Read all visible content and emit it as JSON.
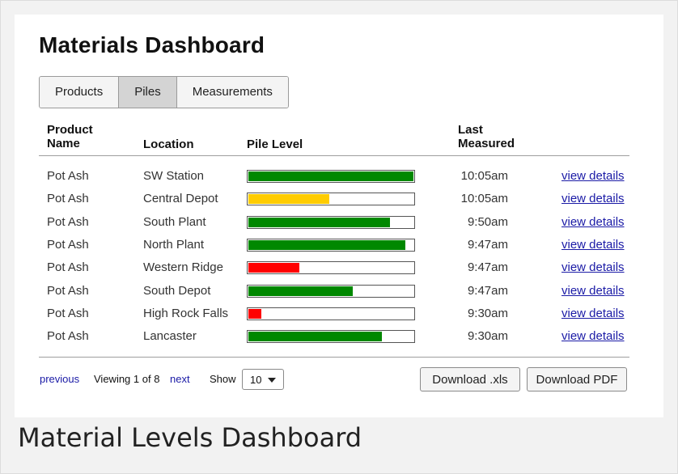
{
  "page": {
    "title": "Materials Dashboard",
    "caption": "Material Levels Dashboard"
  },
  "tabs": [
    {
      "label": "Products",
      "active": false
    },
    {
      "label": "Piles",
      "active": true
    },
    {
      "label": "Measurements",
      "active": false
    }
  ],
  "table": {
    "headers": {
      "product_line1": "Product",
      "product_line2": "Name",
      "location": "Location",
      "pile_level": "Pile Level",
      "last_line1": "Last",
      "last_line2": "Measured"
    },
    "link_label": "view details",
    "rows": [
      {
        "product": "Pot Ash",
        "location": "SW Station",
        "level": 100,
        "color": "#008800",
        "time": "10:05am"
      },
      {
        "product": "Pot Ash",
        "location": "Central Depot",
        "level": 49,
        "color": "#ffcc00",
        "time": "10:05am"
      },
      {
        "product": "Pot Ash",
        "location": "South Plant",
        "level": 86,
        "color": "#008800",
        "time": "9:50am"
      },
      {
        "product": "Pot Ash",
        "location": "North Plant",
        "level": 95,
        "color": "#008800",
        "time": "9:47am"
      },
      {
        "product": "Pot Ash",
        "location": "Western Ridge",
        "level": 31,
        "color": "#ff0000",
        "time": "9:47am"
      },
      {
        "product": "Pot Ash",
        "location": "South Depot",
        "level": 63,
        "color": "#008800",
        "time": "9:47am"
      },
      {
        "product": "Pot Ash",
        "location": "High Rock Falls",
        "level": 8,
        "color": "#ff0000",
        "time": "9:30am"
      },
      {
        "product": "Pot Ash",
        "location": "Lancaster",
        "level": 81,
        "color": "#008800",
        "time": "9:30am"
      }
    ]
  },
  "footer": {
    "previous": "previous",
    "viewing": "Viewing 1 of 8",
    "next": "next",
    "show": "Show",
    "show_value": "10",
    "download_xls": "Download .xls",
    "download_pdf": "Download PDF"
  }
}
